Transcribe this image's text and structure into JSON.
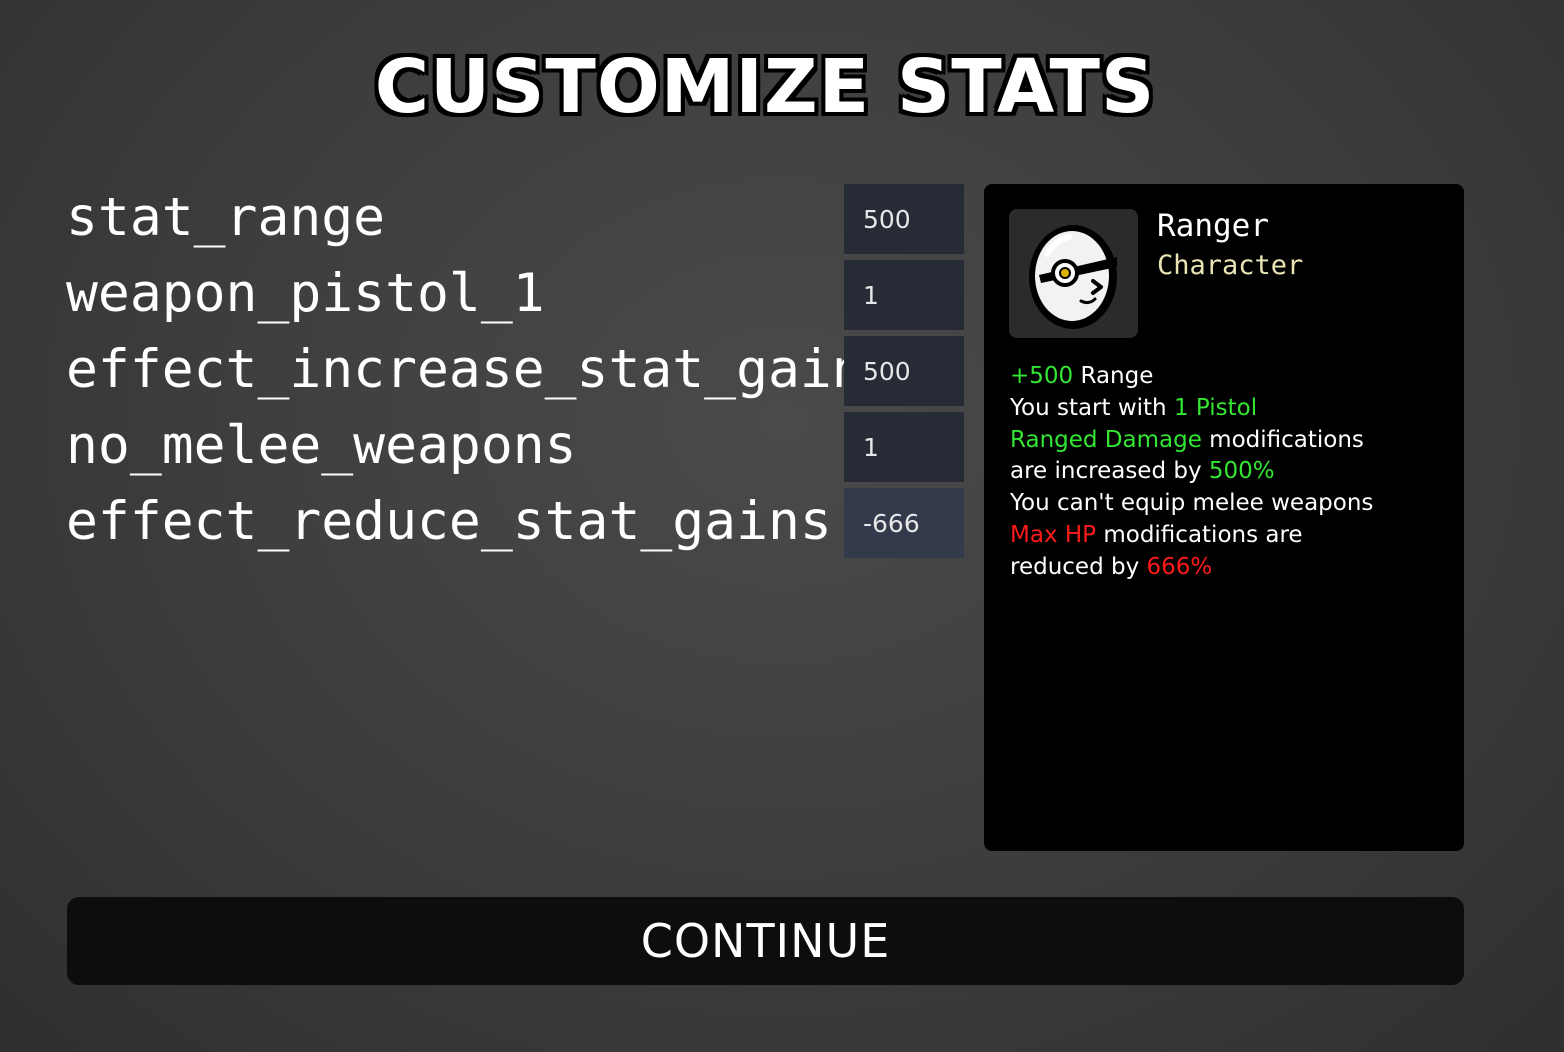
{
  "title": "CUSTOMIZE STATS",
  "stats": [
    {
      "label": "stat_range",
      "value": "500"
    },
    {
      "label": "weapon_pistol_1",
      "value": "1"
    },
    {
      "label": "effect_increase_stat_gains",
      "value": "500"
    },
    {
      "label": "no_melee_weapons",
      "value": "1"
    },
    {
      "label": "effect_reduce_stat_gains",
      "value": "-666"
    }
  ],
  "character": {
    "name": "Ranger",
    "type": "Character",
    "portrait_icon": "ranger-egg-with-monocle-icon",
    "effects": [
      [
        {
          "text": "+500",
          "color": "green"
        },
        {
          "text": " Range",
          "color": "white"
        }
      ],
      [
        {
          "text": "You start with ",
          "color": "white"
        },
        {
          "text": "1 Pistol",
          "color": "green"
        }
      ],
      [
        {
          "text": "Ranged Damage",
          "color": "green"
        },
        {
          "text": " modifications",
          "color": "white"
        }
      ],
      [
        {
          "text": "are increased by ",
          "color": "white"
        },
        {
          "text": "500%",
          "color": "green"
        }
      ],
      [
        {
          "text": "You can't equip melee weapons",
          "color": "white"
        }
      ],
      [
        {
          "text": "Max HP",
          "color": "red"
        },
        {
          "text": " modifications are",
          "color": "white"
        }
      ],
      [
        {
          "text": "reduced by ",
          "color": "white"
        },
        {
          "text": "666%",
          "color": "red"
        }
      ]
    ]
  },
  "continue_label": "CONTINUE",
  "colors": {
    "positive": "#33e633",
    "negative": "#ff1a1a",
    "character_type": "#eae3b4",
    "input_bg": "#262b36",
    "input_focused_bg": "#333a4b"
  }
}
